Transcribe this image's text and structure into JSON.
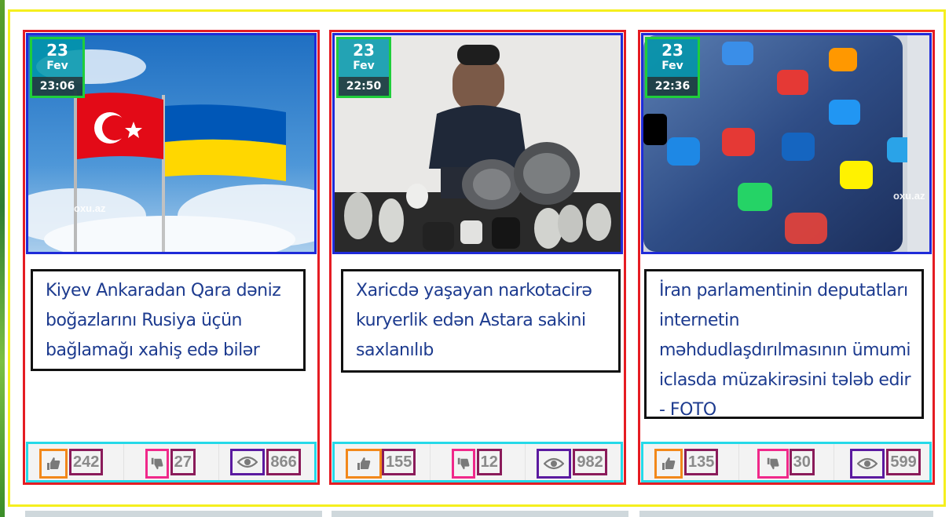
{
  "cards": [
    {
      "date": {
        "day": "23",
        "month": "Fev",
        "time": "23:06"
      },
      "title": "Kiyev Ankaradan Qara dəniz boğazlarını Rusiya üçün bağlamağı xahiş edə bilər",
      "watermark": "oxu.az",
      "stats": {
        "likes": "242",
        "dislikes": "27",
        "views": "866"
      }
    },
    {
      "date": {
        "day": "23",
        "month": "Fev",
        "time": "22:50"
      },
      "title": "Xaricdə yaşayan narkotacirə kuryerlik edən Astara sakini saxlanılıb",
      "stats": {
        "likes": "155",
        "dislikes": "12",
        "views": "982"
      }
    },
    {
      "date": {
        "day": "23",
        "month": "Fev",
        "time": "22:36"
      },
      "title": "İran parlamentinin deputatları internetin məhdudlaşdırılmasının ümumi iclasda müzakirəsini tələb edir - FOTO",
      "watermark": "oxu.az",
      "stats": {
        "likes": "135",
        "dislikes": "30",
        "views": "599"
      }
    }
  ],
  "icons": {
    "like": "thumbs-up-icon",
    "dislike": "thumbs-down-icon",
    "views": "eye-icon"
  },
  "colors": {
    "accent_teal": "#0096aa",
    "title_blue": "#1d3b8f",
    "stat_gray": "#8a8a8a"
  }
}
